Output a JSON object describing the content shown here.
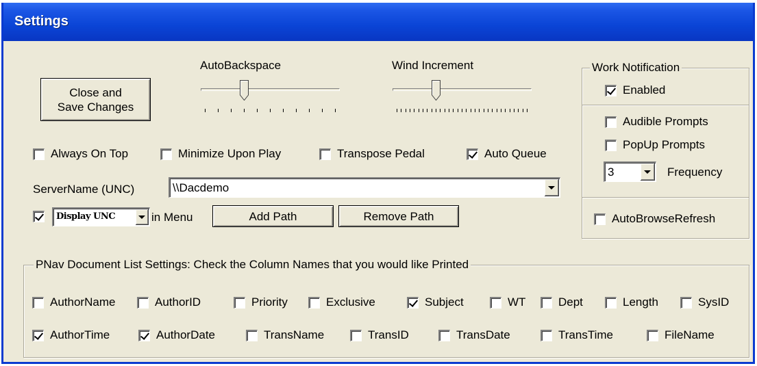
{
  "window": {
    "title": "Settings"
  },
  "close_button": {
    "label_line1": "Close and",
    "label_line2": "Save Changes"
  },
  "autobackspace": {
    "label": "AutoBackspace",
    "value_fraction": 0.3,
    "ticks": 10
  },
  "wind_increment": {
    "label": "Wind Increment",
    "value_fraction": 0.3,
    "ticks": 30
  },
  "options": {
    "always_on_top": {
      "label": "Always On Top",
      "checked": false
    },
    "minimize_upon_play": {
      "label": "Minimize Upon Play",
      "checked": false
    },
    "transpose_pedal": {
      "label": "Transpose Pedal",
      "checked": false
    },
    "auto_queue": {
      "label": "Auto Queue",
      "checked": true
    }
  },
  "server": {
    "label": "ServerName (UNC)",
    "value": "\\\\Dacdemo"
  },
  "menu_row": {
    "display_checked": true,
    "display_select_value": "Display UNC",
    "in_menu_label": "in Menu",
    "add_path_label": "Add Path",
    "remove_path_label": "Remove Path"
  },
  "work_notification": {
    "legend": "Work Notification",
    "enabled": {
      "label": "Enabled",
      "checked": true
    },
    "audible_prompts": {
      "label": "Audible Prompts",
      "checked": false
    },
    "popup_prompts": {
      "label": "PopUp Prompts",
      "checked": false
    },
    "frequency_value": "3",
    "frequency_label": "Frequency",
    "autobrowse_refresh": {
      "label": "AutoBrowseRefresh",
      "checked": false
    }
  },
  "doc_list": {
    "legend": "PNav Document List Settings:  Check the Column Names that you would like Printed",
    "row1": [
      {
        "label": "AuthorName",
        "checked": false
      },
      {
        "label": "AuthorID",
        "checked": false
      },
      {
        "label": "Priority",
        "checked": false
      },
      {
        "label": "Exclusive",
        "checked": false
      },
      {
        "label": "Subject",
        "checked": true
      },
      {
        "label": "WT",
        "checked": false
      },
      {
        "label": "Dept",
        "checked": false
      },
      {
        "label": "Length",
        "checked": false
      },
      {
        "label": "SysID",
        "checked": false
      }
    ],
    "row2": [
      {
        "label": "AuthorTime",
        "checked": true
      },
      {
        "label": "AuthorDate",
        "checked": true
      },
      {
        "label": "TransName",
        "checked": false
      },
      {
        "label": "TransID",
        "checked": false
      },
      {
        "label": "TransDate",
        "checked": false
      },
      {
        "label": "TransTime",
        "checked": false
      },
      {
        "label": "FileName",
        "checked": false
      }
    ]
  }
}
